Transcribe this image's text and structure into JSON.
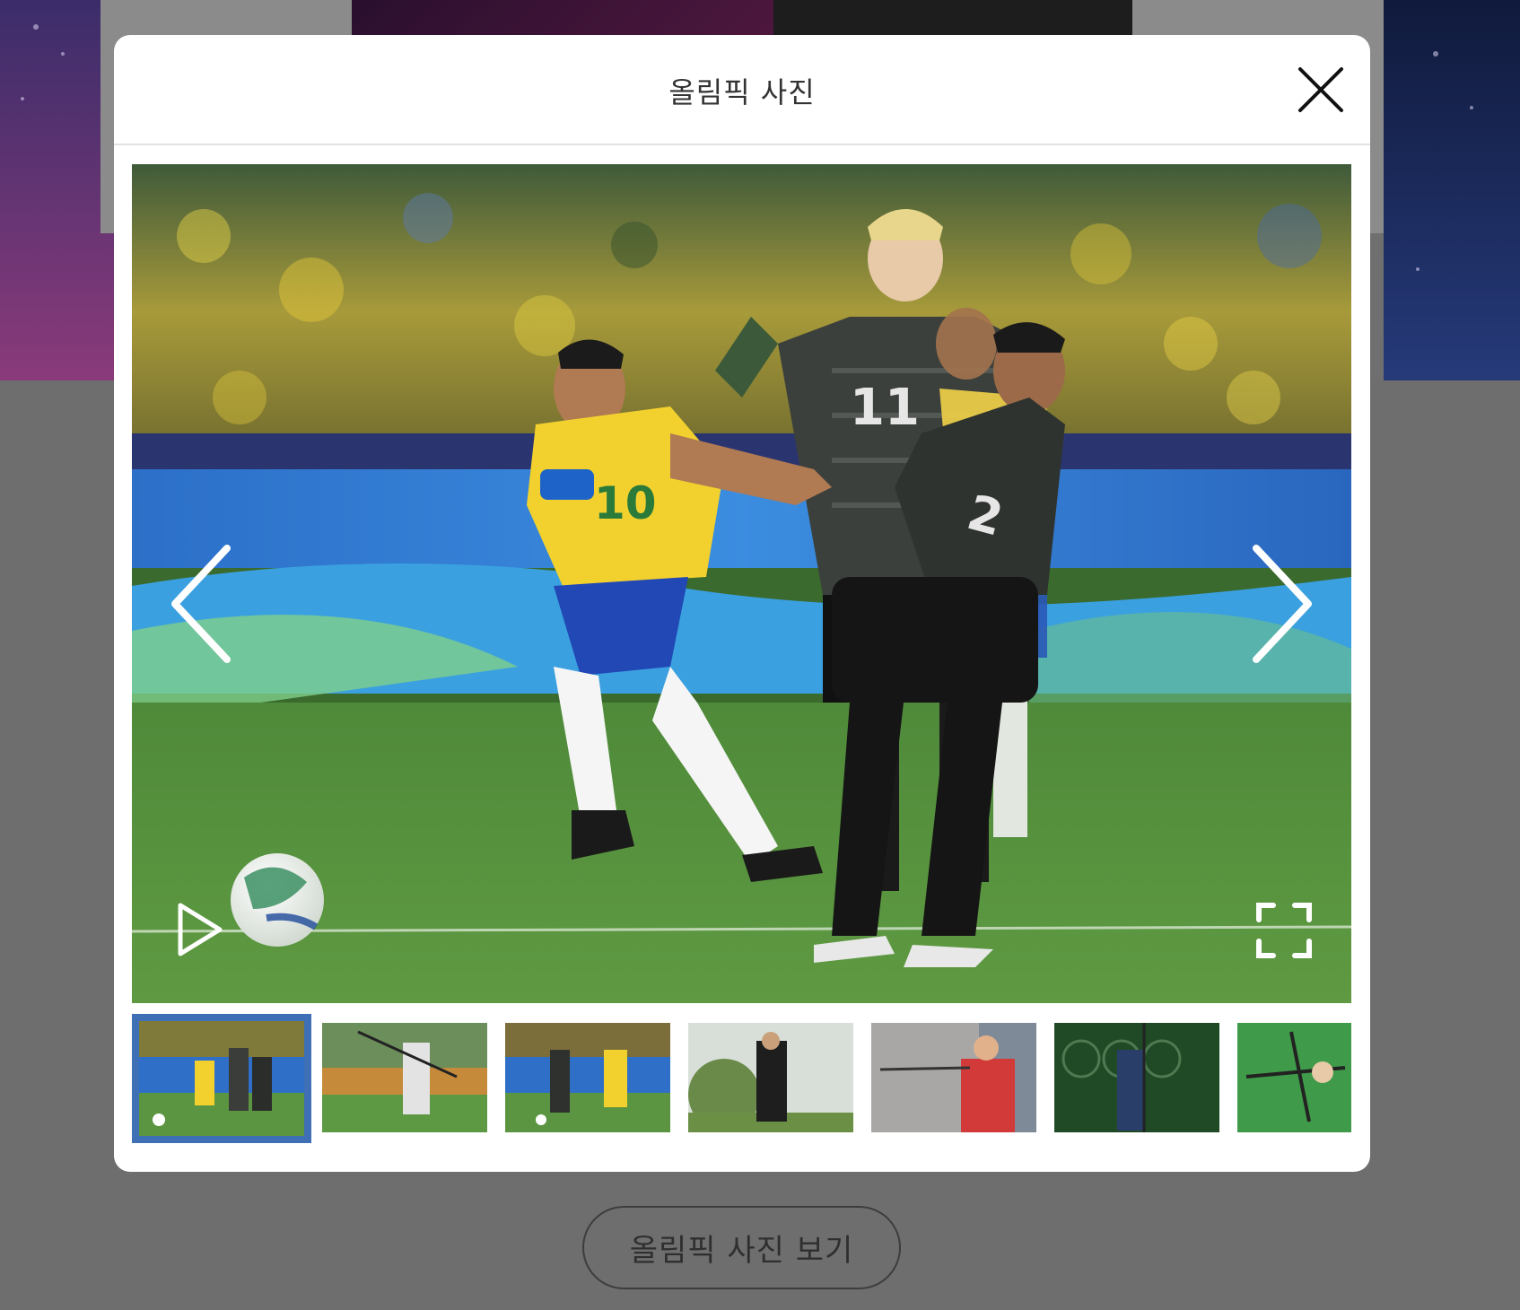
{
  "modal": {
    "title": "올림픽 사진",
    "close_icon": "close-icon"
  },
  "viewer": {
    "prev_icon": "chevron-left-icon",
    "next_icon": "chevron-right-icon",
    "play_icon": "play-icon",
    "fullscreen_icon": "fullscreen-icon",
    "photo_jersey_numbers": [
      "10",
      "11",
      "2"
    ]
  },
  "thumbnails": {
    "count": 7,
    "active_index": 0,
    "accent_color": "#3f6fb5"
  },
  "page": {
    "open_gallery_label": "올림픽 사진 보기"
  },
  "colors": {
    "overlay_dim": "#6f6f6f",
    "modal_bg": "#ffffff"
  }
}
